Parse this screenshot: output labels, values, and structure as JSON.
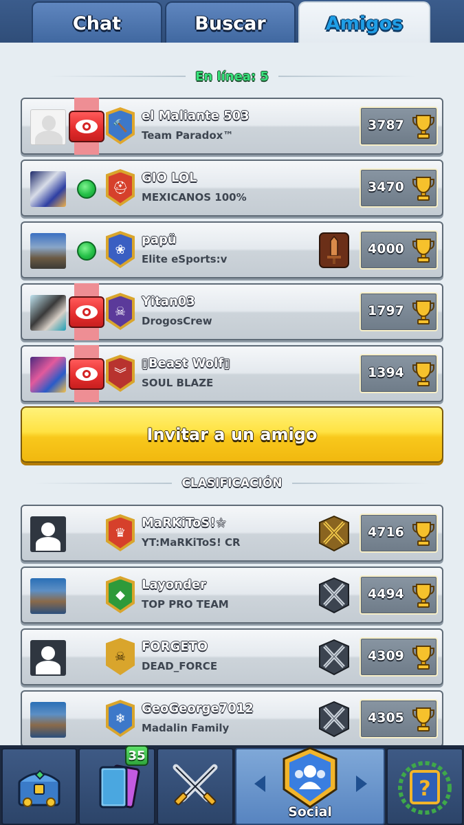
{
  "tabs": [
    {
      "label": "Chat",
      "active": false
    },
    {
      "label": "Buscar",
      "active": false
    },
    {
      "label": "Amigos",
      "active": true
    }
  ],
  "online_header": "En línea: 5",
  "friends_online": [
    {
      "name": "el Maliante 503",
      "clan": "Team Paradox™",
      "trophies": "3787",
      "status": "spectate",
      "avatar": "default",
      "clan_badge_color": "#3d78c9",
      "clan_badge_icon": "hammer-icon"
    },
    {
      "name": "GIO LOL",
      "clan": "MEXICANOS 100%",
      "trophies": "3470",
      "status": "online",
      "avatar": "photo",
      "clan_badge_color": "#d6402b",
      "clan_badge_icon": "helmet-icon"
    },
    {
      "name": "papü",
      "clan": "Elite eSports:v",
      "trophies": "4000",
      "status": "online",
      "avatar": "photo",
      "clan_badge_color": "#3a5fc2",
      "clan_badge_icon": "lotus-icon",
      "arena_icon": "sword-icon"
    },
    {
      "name": "Yitan03",
      "clan": "DrogosCrew",
      "trophies": "1797",
      "status": "spectate",
      "avatar": "photo",
      "clan_badge_color": "#5b3a9a",
      "clan_badge_icon": "skull-icon"
    },
    {
      "name": "▯Beast Wolf▯",
      "clan": "SOUL BLAZE",
      "trophies": "1394",
      "status": "spectate",
      "avatar": "photo",
      "clan_badge_color": "#b8332f",
      "clan_badge_icon": "chevron-icon"
    }
  ],
  "invite_button": "Invitar a un amigo",
  "ranking_header": "CLASIFICACIÓN",
  "ranking": [
    {
      "name": "MaRKiToS!☆",
      "clan": "YT:MaRKiToS! CR",
      "trophies": "4716",
      "avatar": "dark",
      "clan_badge_color": "#d6402b",
      "clan_badge_icon": "crown-icon",
      "arena_icon": "gold-swords-icon"
    },
    {
      "name": "Layonder",
      "clan": "TOP PRO TEAM",
      "trophies": "4494",
      "avatar": "photo",
      "clan_badge_color": "#2e9a3a",
      "clan_badge_icon": "brazil-flag-icon",
      "arena_icon": "silver-swords-icon"
    },
    {
      "name": "FORGETO",
      "clan": "DEAD_FORCE",
      "trophies": "4309",
      "avatar": "dark",
      "clan_badge_color": "#d9a52c",
      "clan_badge_icon": "skull-icon",
      "arena_icon": "silver-swords-icon"
    },
    {
      "name": "GeoGeorge7012",
      "clan": "Madalin Family",
      "trophies": "4305",
      "avatar": "photo",
      "clan_badge_color": "#3d78c9",
      "clan_badge_icon": "snowflake-icon",
      "arena_icon": "silver-swords-icon"
    }
  ],
  "bottom_nav": [
    {
      "icon": "chest-icon",
      "label": ""
    },
    {
      "icon": "cards-icon",
      "label": "",
      "badge": "35"
    },
    {
      "icon": "crossed-swords-icon",
      "label": ""
    },
    {
      "icon": "social-icon",
      "label": "Social",
      "active": true
    },
    {
      "icon": "quests-icon",
      "label": ""
    }
  ]
}
